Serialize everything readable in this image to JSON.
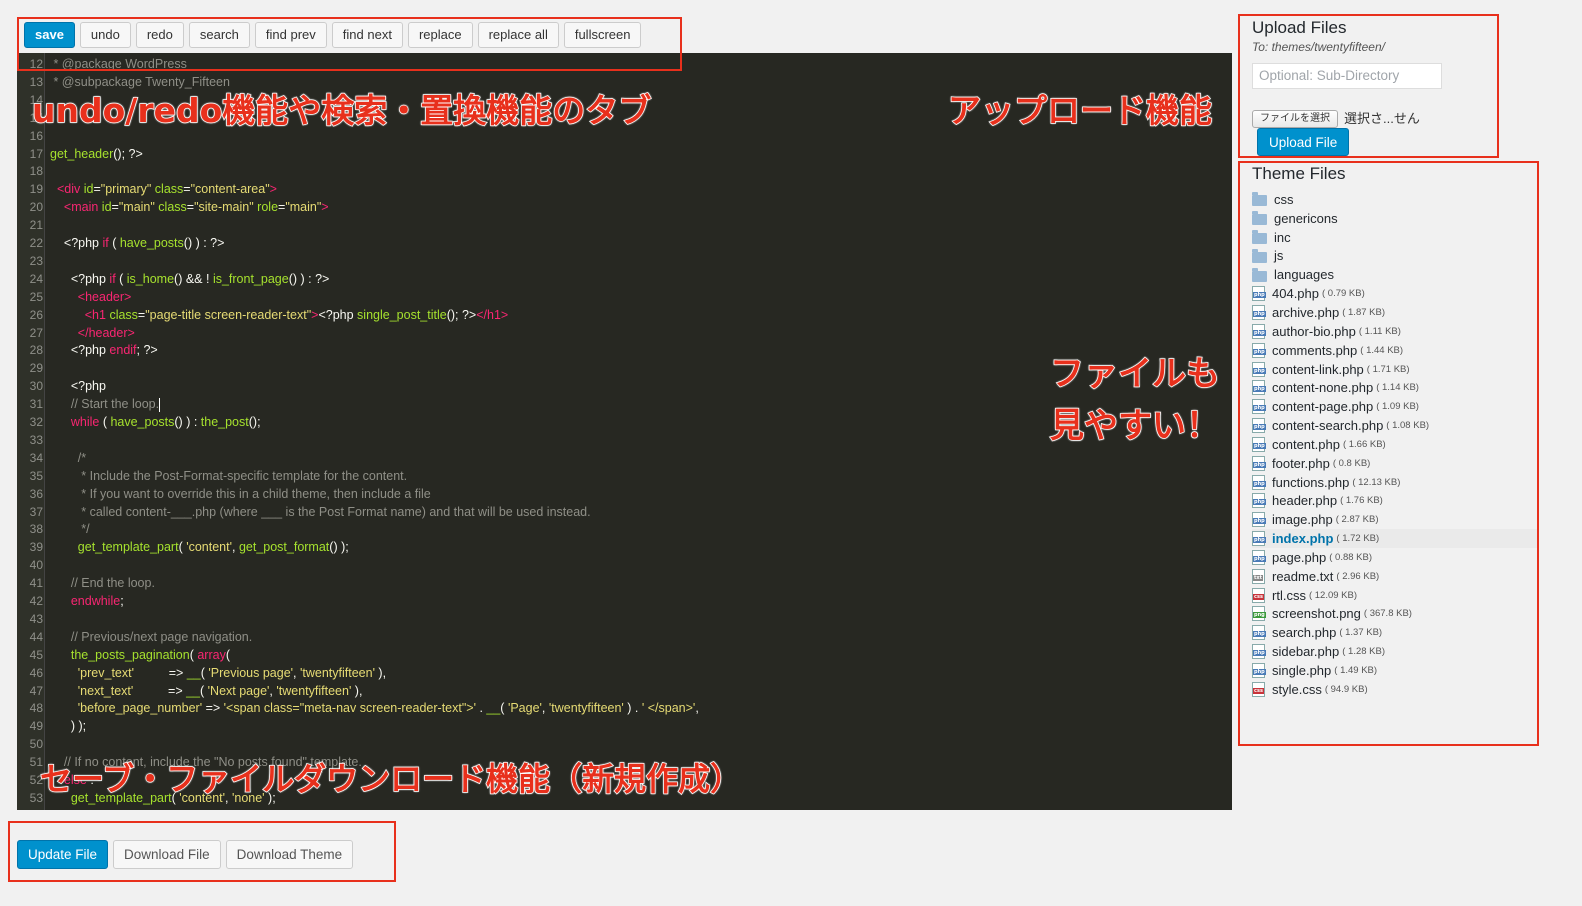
{
  "toolbar": {
    "buttons": [
      "save",
      "undo",
      "redo",
      "search",
      "find prev",
      "find next",
      "replace",
      "replace all",
      "fullscreen"
    ]
  },
  "editor": {
    "lines": [
      {
        "n": "12",
        "html": "<span class='c-com'> * @package WordPress</span>"
      },
      {
        "n": "13",
        "html": "<span class='c-com'> * @subpackage Twenty_Fifteen</span>"
      },
      {
        "n": "14",
        "html": ""
      },
      {
        "n": "15",
        "html": ""
      },
      {
        "n": "16",
        "html": ""
      },
      {
        "n": "17",
        "html": "<span class='c-fn'>get_header</span>(); ?&gt;"
      },
      {
        "n": "18",
        "html": ""
      },
      {
        "n": "19",
        "html": "  <span class='c-kw'>&lt;div</span> <span class='c-fn'>id</span>=<span class='c-str'>\"primary\"</span> <span class='c-fn'>class</span>=<span class='c-str'>\"content-area\"</span><span class='c-kw'>&gt;</span>"
      },
      {
        "n": "20",
        "html": "    <span class='c-kw'>&lt;main</span> <span class='c-fn'>id</span>=<span class='c-str'>\"main\"</span> <span class='c-fn'>class</span>=<span class='c-str'>\"site-main\"</span> <span class='c-fn'>role</span>=<span class='c-str'>\"main\"</span><span class='c-kw'>&gt;</span>"
      },
      {
        "n": "21",
        "html": ""
      },
      {
        "n": "22",
        "html": "    &lt;?php <span class='c-kw'>if</span> ( <span class='c-fn'>have_posts</span>() ) : ?&gt;"
      },
      {
        "n": "23",
        "html": ""
      },
      {
        "n": "24",
        "html": "      &lt;?php <span class='c-kw'>if</span> ( <span class='c-fn'>is_home</span>() &amp;&amp; ! <span class='c-fn'>is_front_page</span>() ) : ?&gt;"
      },
      {
        "n": "25",
        "html": "        <span class='c-kw'>&lt;header&gt;</span>"
      },
      {
        "n": "26",
        "html": "          <span class='c-kw'>&lt;h1</span> <span class='c-fn'>class</span>=<span class='c-str'>\"page-title screen-reader-text\"</span><span class='c-kw'>&gt;</span>&lt;?php <span class='c-fn'>single_post_title</span>(); ?&gt;<span class='c-kw'>&lt;/h1&gt;</span>"
      },
      {
        "n": "27",
        "html": "        <span class='c-kw'>&lt;/header&gt;</span>"
      },
      {
        "n": "28",
        "html": "      &lt;?php <span class='c-kw'>endif</span>; ?&gt;"
      },
      {
        "n": "29",
        "html": ""
      },
      {
        "n": "30",
        "html": "      &lt;?php"
      },
      {
        "n": "31",
        "html": "      <span class='c-com'>// Start the loop.</span><span class='cursor'></span>"
      },
      {
        "n": "32",
        "html": "      <span class='c-kw'>while</span> ( <span class='c-fn'>have_posts</span>() ) : <span class='c-fn'>the_post</span>();"
      },
      {
        "n": "33",
        "html": ""
      },
      {
        "n": "34",
        "html": "        <span class='c-com'>/*</span>"
      },
      {
        "n": "35",
        "html": "<span class='c-com'>         * Include the Post-Format-specific template for the content.</span>"
      },
      {
        "n": "36",
        "html": "<span class='c-com'>         * If you want to override this in a child theme, then include a file</span>"
      },
      {
        "n": "37",
        "html": "<span class='c-com'>         * called content-___.php (where ___ is the Post Format name) and that will be used instead.</span>"
      },
      {
        "n": "38",
        "html": "<span class='c-com'>         */</span>"
      },
      {
        "n": "39",
        "html": "        <span class='c-fn'>get_template_part</span>( <span class='c-str'>'content'</span>, <span class='c-fn'>get_post_format</span>() );"
      },
      {
        "n": "40",
        "html": ""
      },
      {
        "n": "41",
        "html": "      <span class='c-com'>// End the loop.</span>"
      },
      {
        "n": "42",
        "html": "      <span class='c-kw'>endwhile</span>;"
      },
      {
        "n": "43",
        "html": ""
      },
      {
        "n": "44",
        "html": "      <span class='c-com'>// Previous/next page navigation.</span>"
      },
      {
        "n": "45",
        "html": "      <span class='c-fn'>the_posts_pagination</span>( <span class='c-kw'>array</span>("
      },
      {
        "n": "46",
        "html": "        <span class='c-str'>'prev_text'</span>          =&gt; <span class='c-fn'>__</span>( <span class='c-str'>'Previous page'</span>, <span class='c-str'>'twentyfifteen'</span> ),"
      },
      {
        "n": "47",
        "html": "        <span class='c-str'>'next_text'</span>          =&gt; <span class='c-fn'>__</span>( <span class='c-str'>'Next page'</span>, <span class='c-str'>'twentyfifteen'</span> ),"
      },
      {
        "n": "48",
        "html": "        <span class='c-str'>'before_page_number'</span> =&gt; <span class='c-str'>'&lt;span class=\"meta-nav screen-reader-text\"&gt;'</span> . <span class='c-fn'>__</span>( <span class='c-str'>'Page'</span>, <span class='c-str'>'twentyfifteen'</span> ) . <span class='c-str'>' &lt;/span&gt;'</span>,"
      },
      {
        "n": "49",
        "html": "      ) );"
      },
      {
        "n": "50",
        "html": ""
      },
      {
        "n": "51",
        "html": "    <span class='c-com'>// If no content, include the \"No posts found\" template.</span>"
      },
      {
        "n": "52",
        "html": "    <span class='c-kw'>else</span> :"
      },
      {
        "n": "53",
        "html": "      <span class='c-fn'>get_template_part</span>( <span class='c-str'>'content'</span>, <span class='c-str'>'none'</span> );"
      },
      {
        "n": "54",
        "html": ""
      }
    ]
  },
  "annotations": {
    "tabs": "undo/redo機能や検索・置換機能のタブ",
    "upload": "アップロード機能",
    "files_line1": "ファイルも",
    "files_line2": "見やすい！",
    "save": "セーブ・ファイルダウンロード機能（新規作成）"
  },
  "bottom": {
    "update": "Update File",
    "download_file": "Download File",
    "download_theme": "Download Theme"
  },
  "upload": {
    "title": "Upload Files",
    "to": "To: themes/twentyfifteen/",
    "placeholder": "Optional: Sub-Directory",
    "choose": "ファイルを選択",
    "nofile": "選択さ...せん",
    "button": "Upload File"
  },
  "theme": {
    "title": "Theme Files",
    "files": [
      {
        "name": "css",
        "type": "folder",
        "size": ""
      },
      {
        "name": "genericons",
        "type": "folder",
        "size": ""
      },
      {
        "name": "inc",
        "type": "folder",
        "size": ""
      },
      {
        "name": "js",
        "type": "folder",
        "size": ""
      },
      {
        "name": "languages",
        "type": "folder",
        "size": ""
      },
      {
        "name": "404.php",
        "type": "php",
        "size": "( 0.79 KB)"
      },
      {
        "name": "archive.php",
        "type": "php",
        "size": "( 1.87 KB)"
      },
      {
        "name": "author-bio.php",
        "type": "php",
        "size": "( 1.11 KB)"
      },
      {
        "name": "comments.php",
        "type": "php",
        "size": "( 1.44 KB)"
      },
      {
        "name": "content-link.php",
        "type": "php",
        "size": "( 1.71 KB)"
      },
      {
        "name": "content-none.php",
        "type": "php",
        "size": "( 1.14 KB)"
      },
      {
        "name": "content-page.php",
        "type": "php",
        "size": "( 1.09 KB)"
      },
      {
        "name": "content-search.php",
        "type": "php",
        "size": "( 1.08 KB)"
      },
      {
        "name": "content.php",
        "type": "php",
        "size": "( 1.66 KB)"
      },
      {
        "name": "footer.php",
        "type": "php",
        "size": "( 0.8 KB)"
      },
      {
        "name": "functions.php",
        "type": "php",
        "size": "( 12.13 KB)"
      },
      {
        "name": "header.php",
        "type": "php",
        "size": "( 1.76 KB)"
      },
      {
        "name": "image.php",
        "type": "php",
        "size": "( 2.87 KB)"
      },
      {
        "name": "index.php",
        "type": "php",
        "size": "( 1.72 KB)",
        "active": true
      },
      {
        "name": "page.php",
        "type": "php",
        "size": "( 0.88 KB)"
      },
      {
        "name": "readme.txt",
        "type": "txt",
        "size": "( 2.96 KB)"
      },
      {
        "name": "rtl.css",
        "type": "css",
        "size": "( 12.09 KB)"
      },
      {
        "name": "screenshot.png",
        "type": "png",
        "size": "( 367.8 KB)"
      },
      {
        "name": "search.php",
        "type": "php",
        "size": "( 1.37 KB)"
      },
      {
        "name": "sidebar.php",
        "type": "php",
        "size": "( 1.28 KB)"
      },
      {
        "name": "single.php",
        "type": "php",
        "size": "( 1.49 KB)"
      },
      {
        "name": "style.css",
        "type": "css",
        "size": "( 94.9 KB)"
      }
    ]
  },
  "colors": {
    "annotation": "#e8301c",
    "primary_button": "#0091cd",
    "editor_bg": "#272822"
  }
}
